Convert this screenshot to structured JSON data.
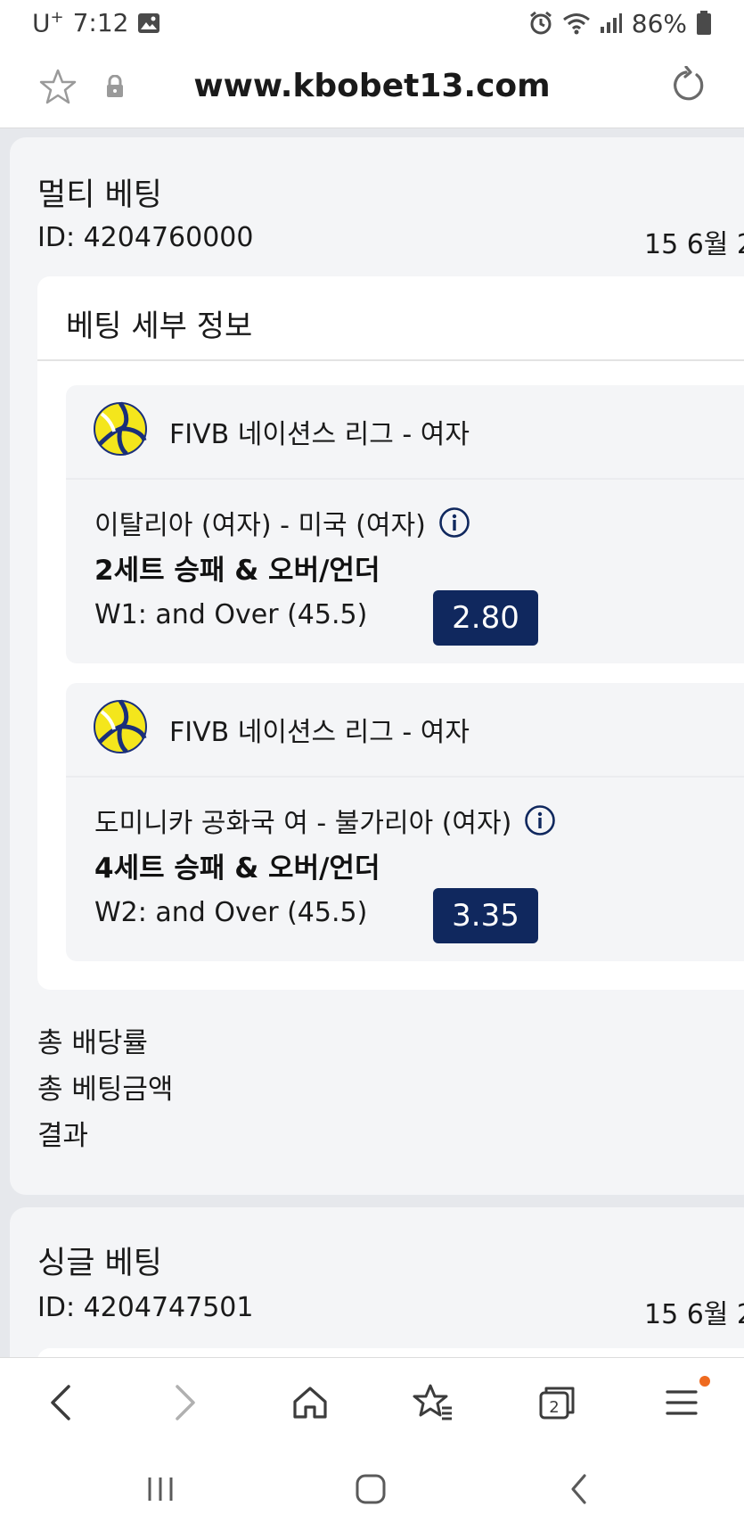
{
  "status_bar": {
    "carrier": "U",
    "carrier_sup": "+",
    "time": "7:12",
    "battery": "86%"
  },
  "browser": {
    "url": "www.kbobet13.com",
    "tab_count": "2"
  },
  "multi_bet": {
    "title": "멀티 베팅",
    "id": "ID: 4204760000",
    "date": "15 6월 2",
    "details_title": "베팅 세부 정보",
    "events": [
      {
        "league": "FIVB 네이션스 리그 - 여자",
        "match": "이탈리아 (여자) - 미국 (여자)",
        "market": "2세트 승패 & 오버/언더",
        "pick": "W1: and Over (45.5)",
        "odds": "2.80"
      },
      {
        "league": "FIVB 네이션스 리그 - 여자",
        "match": "도미니카 공화국 여 - 불가리아 (여자)",
        "market": "4세트 승패 & 오버/언더",
        "pick": "W2: and Over (45.5)",
        "odds": "3.35"
      }
    ],
    "summary": {
      "total_odds_label": "총 배당률",
      "total_stake_label": "총 베팅금액",
      "result_label": "결과"
    }
  },
  "single_bet": {
    "title": "싱글 베팅",
    "id": "ID: 4204747501",
    "date": "15 6월 2"
  },
  "colors": {
    "odds_bg": "#10285e",
    "live_dot": "#e8334a",
    "notification_dot": "#ee6a1f"
  },
  "icons": [
    "star-icon",
    "lock-icon",
    "reload-icon",
    "volleyball-icon",
    "info-icon",
    "back-icon",
    "forward-icon",
    "home-icon",
    "bookmarks-icon",
    "tabs-icon",
    "menu-icon"
  ]
}
